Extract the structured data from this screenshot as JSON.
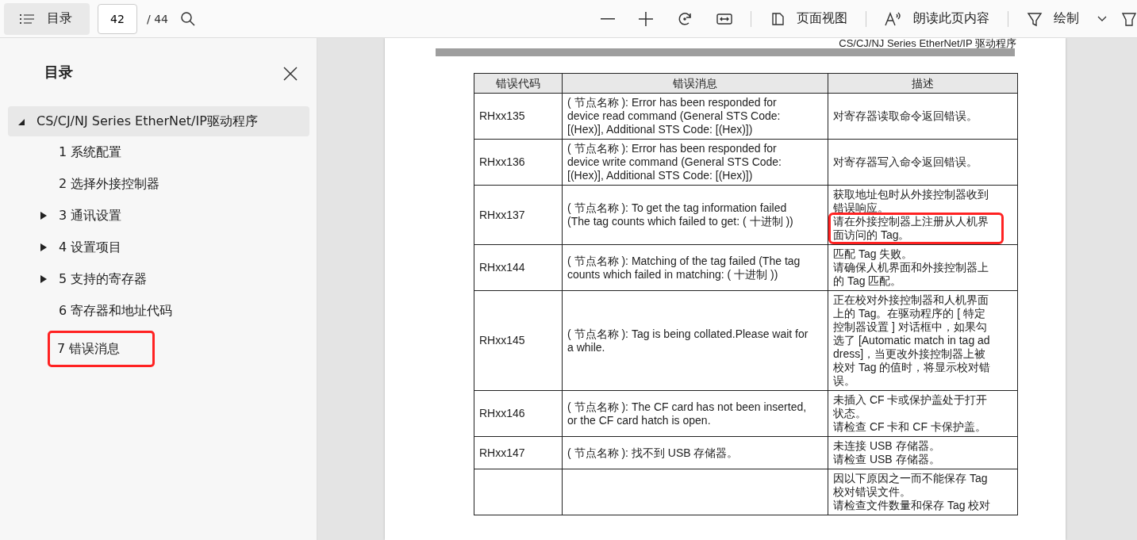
{
  "toolbar": {
    "toc_button": {
      "label": "目录",
      "selected": true
    },
    "page_input": {
      "value": "42"
    },
    "page_total": "/ 44",
    "page_view": "页面视图",
    "read_aloud": "朗读此页内容",
    "draw": "绘制"
  },
  "sidebar": {
    "title": "目录",
    "items": [
      {
        "label": "CS/CJ/NJ Series EtherNet/IP驱动程序",
        "kind": "branch",
        "expanded": true,
        "selected": true,
        "highlighted": false,
        "children": [
          {
            "label": "1 系统配置",
            "kind": "leaf",
            "selected": false,
            "highlighted": false
          },
          {
            "label": "2 选择外接控制器",
            "kind": "leaf",
            "selected": false,
            "highlighted": false
          },
          {
            "label": "3 通讯设置",
            "kind": "branch",
            "expanded": false,
            "selected": false,
            "highlighted": false
          },
          {
            "label": "4 设置项目",
            "kind": "branch",
            "expanded": false,
            "selected": false,
            "highlighted": false
          },
          {
            "label": "5 支持的寄存器",
            "kind": "branch",
            "expanded": false,
            "selected": false,
            "highlighted": false
          },
          {
            "label": "6 寄存器和地址代码",
            "kind": "leaf",
            "selected": false,
            "highlighted": false
          },
          {
            "label": "7 错误消息",
            "kind": "leaf",
            "selected": false,
            "highlighted": true
          }
        ]
      }
    ]
  },
  "document": {
    "running_header": "CS/CJ/NJ Series EtherNet/IP 驱动程序",
    "table": {
      "columns": [
        "错误代码",
        "错误消息",
        "描述"
      ],
      "rows": [
        {
          "code": "RHxx135",
          "message": "( 节点名称 ): Error has been responded for\ndevice read command (General STS Code:\n[(Hex)], Additional STS Code: [(Hex)])",
          "description": [
            {
              "text": "对寄存器读取命令返回错误。",
              "highlighted": false
            }
          ]
        },
        {
          "code": "RHxx136",
          "message": "( 节点名称 ): Error has been responded for\ndevice write command (General STS Code:\n[(Hex)], Additional STS Code: [(Hex)])",
          "description": [
            {
              "text": "对寄存器写入命令返回错误。",
              "highlighted": false
            }
          ]
        },
        {
          "code": "RHxx137",
          "message": "( 节点名称 ): To get the tag information failed\n(The tag counts which failed to get: ( 十进制 ))",
          "description": [
            {
              "text": "获取地址包时从外接控制器收到错误响应。",
              "highlighted": false
            },
            {
              "text": "请在外接控制器上注册从人机界面访问的 Tag。",
              "highlighted": true
            }
          ]
        },
        {
          "code": "RHxx144",
          "message": "( 节点名称 ): Matching of the tag failed (The tag\ncounts which failed in matching: ( 十进制 ))",
          "description": [
            {
              "text": "匹配 Tag 失败。",
              "highlighted": false
            },
            {
              "text": "请确保人机界面和外接控制器上的 Tag 匹配。",
              "highlighted": false
            }
          ]
        },
        {
          "code": "RHxx145",
          "message": "( 节点名称 ): Tag is being collated.Please wait for\na while.",
          "description": [
            {
              "text": "正在校对外接控制器和人机界面上的 Tag。在驱动程序的 [ 特定控制器设置 ] 对话框中，如果勾选了 [Automatic match in tag address]，当更改外接控制器上被校对 Tag 的值时，将显示校对错误。",
              "highlighted": false
            }
          ]
        },
        {
          "code": "RHxx146",
          "message": "( 节点名称 ): The CF card has not been inserted,\nor the CF card hatch is open.",
          "description": [
            {
              "text": "未插入 CF 卡或保护盖处于打开状态。",
              "highlighted": false
            },
            {
              "text": "请检查 CF 卡和 CF 卡保护盖。",
              "highlighted": false
            }
          ]
        },
        {
          "code": "RHxx147",
          "message": "( 节点名称 ): 找不到 USB 存储器。",
          "description": [
            {
              "text": "未连接 USB 存储器。",
              "highlighted": false
            },
            {
              "text": "请检查 USB 存储器。",
              "highlighted": false
            }
          ]
        },
        {
          "code": "",
          "message": "",
          "description": [
            {
              "text": "因以下原因之一而不能保存 Tag 校对错误文件。",
              "highlighted": false
            },
            {
              "text": "请检查文件数量和保存 Tag 校对",
              "highlighted": false
            }
          ]
        }
      ]
    }
  }
}
